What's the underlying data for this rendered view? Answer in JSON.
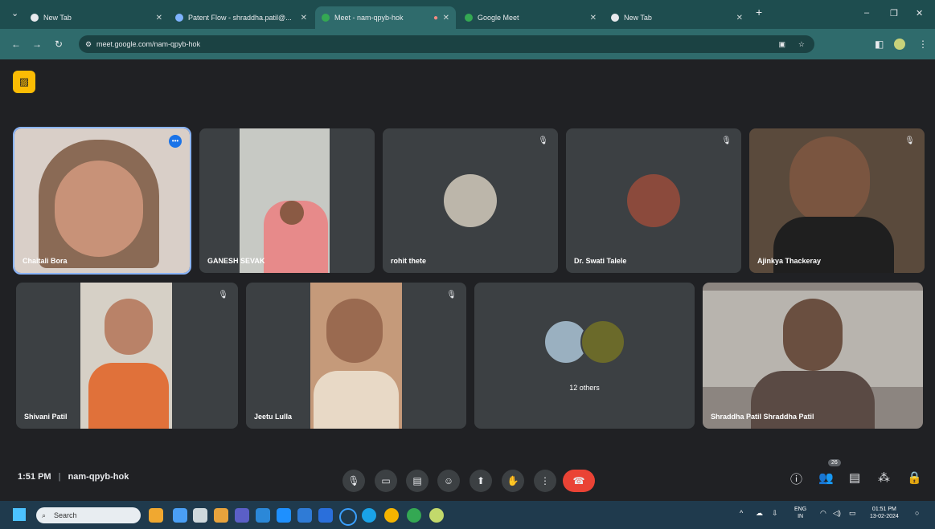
{
  "browser": {
    "tabs": [
      {
        "label": "New Tab",
        "active": false
      },
      {
        "label": "Patent Flow - shraddha.patil@...",
        "active": false
      },
      {
        "label": "Meet - nam-qpyb-hok",
        "active": true
      },
      {
        "label": "Google Meet",
        "active": false
      },
      {
        "label": "New Tab",
        "active": false
      }
    ],
    "new_tab": "+",
    "url": "meet.google.com/nam-qpyb-hok"
  },
  "meeting": {
    "participants": [
      {
        "name": "Chaitali Bora",
        "muted": false,
        "speaking": true
      },
      {
        "name": "GANESH SEVAK",
        "muted": false
      },
      {
        "name": "rohit thete",
        "muted": true
      },
      {
        "name": "Dr. Swati Talele",
        "muted": true
      },
      {
        "name": "Ajinkya Thackeray",
        "muted": true
      },
      {
        "name": "Shivani Patil",
        "muted": true
      },
      {
        "name": "Jeetu Lulla",
        "muted": true
      },
      {
        "name": "12 others",
        "muted": false
      },
      {
        "name": "Shraddha Patil Shraddha Patil",
        "muted": false
      }
    ],
    "time": "1:51 PM",
    "meeting_code": "nam-qpyb-hok",
    "participant_count": "26"
  },
  "taskbar": {
    "search_placeholder": "Search",
    "lang": "ENG",
    "region": "IN",
    "clock_time": "01:51 PM",
    "clock_date": "13-02-2024"
  },
  "colors": {
    "tab_bg": "#1e4d4f",
    "meet_bg": "#202124",
    "tile_bg": "#3c4043",
    "end_call": "#ea4335",
    "speaking_outline": "#8ab4f8"
  }
}
